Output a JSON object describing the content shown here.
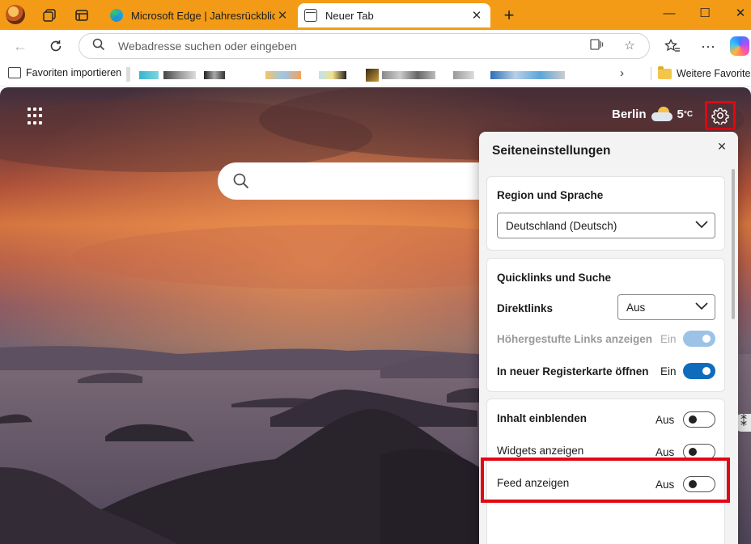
{
  "tabs": {
    "inactive": {
      "label": "Microsoft Edge | Jahresrückblick"
    },
    "active": {
      "label": "Neuer Tab"
    }
  },
  "window": {
    "minimize": "—",
    "maximize": "☐",
    "close": "✕"
  },
  "address_bar": {
    "placeholder": "Webadresse suchen oder eingeben"
  },
  "favorites_bar": {
    "import_label": "Favoriten importieren",
    "other_label": "Weitere Favoriten"
  },
  "ntp": {
    "weather": {
      "city": "Berlin",
      "temp": "5",
      "unit": "°C"
    }
  },
  "settings_panel": {
    "title": "Seiteneinstellungen",
    "region": {
      "header": "Region und Sprache",
      "selected": "Deutschland (Deutsch)"
    },
    "quicklinks": {
      "header": "Quicklinks und Suche",
      "direktlinks_label": "Direktlinks",
      "direktlinks_value": "Aus",
      "promoted_label": "Höhergestufte Links anzeigen",
      "promoted_state": "Ein",
      "newtab_label": "In neuer Registerkarte öffnen",
      "newtab_state": "Ein"
    },
    "content": {
      "inhalt_label": "Inhalt einblenden",
      "inhalt_state": "Aus",
      "widgets_label": "Widgets anzeigen",
      "widgets_state": "Aus",
      "feed_label": "Feed anzeigen",
      "feed_state": "Aus"
    }
  },
  "colors": {
    "accent": "#0f6cbd",
    "tabbar": "#f39b17",
    "highlight": "#e30613"
  }
}
